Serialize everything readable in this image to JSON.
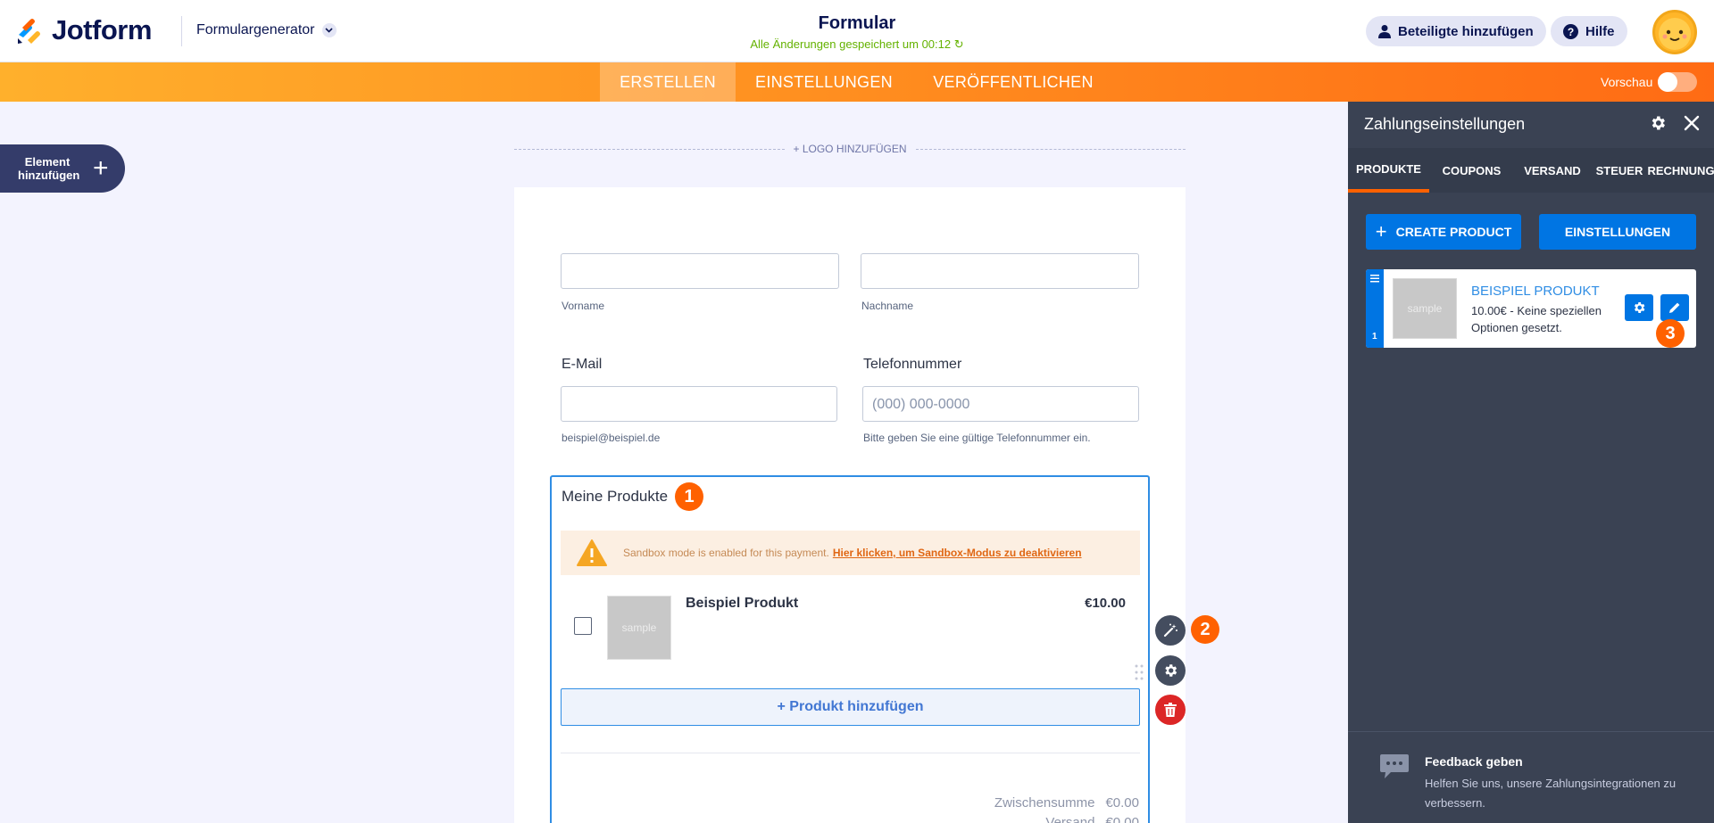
{
  "header": {
    "logo_text": "Jotform",
    "builder_menu": "Formulargenerator",
    "form_title": "Formular",
    "save_status": "Alle Änderungen gespeichert um 00:12",
    "add_participants": "Beteiligte hinzufügen",
    "help": "Hilfe"
  },
  "navbar": {
    "tabs": [
      {
        "label": "ERSTELLEN",
        "active": true
      },
      {
        "label": "EINSTELLUNGEN",
        "active": false
      },
      {
        "label": "VERÖFFENTLICHEN",
        "active": false
      }
    ],
    "preview_label": "Vorschau"
  },
  "sidebar": {
    "add_element_label": "Element hinzufügen"
  },
  "form": {
    "logo_add": "+ LOGO HINZUFÜGEN",
    "first_name_sub": "Vorname",
    "last_name_sub": "Nachname",
    "email_label": "E-Mail",
    "email_sub": "beispiel@beispiel.de",
    "phone_label": "Telefonnummer",
    "phone_placeholder": "(000) 000-0000",
    "phone_sub": "Bitte geben Sie eine gültige Telefonnummer ein.",
    "products": {
      "title": "Meine Produkte",
      "badge": "1",
      "sandbox_text": "Sandbox mode is enabled for this payment.",
      "sandbox_link": "Hier klicken, um Sandbox-Modus zu deaktivieren",
      "item_name": "Beispiel Produkt",
      "item_price": "€10.00",
      "thumb_text": "sample",
      "add_product": "+ Produkt hinzufügen",
      "subtotal_label": "Zwischensumme",
      "subtotal_value": "€0.00",
      "shipping_label": "Versand",
      "shipping_value": "€0.00"
    },
    "badge_2": "2"
  },
  "panel": {
    "title": "Zahlungseinstellungen",
    "tabs": [
      "PRODUKTE",
      "COUPONS",
      "VERSAND",
      "STEUER",
      "RECHNUNG"
    ],
    "create_product": "CREATE PRODUCT",
    "settings": "EINSTELLUNGEN",
    "product": {
      "index": "1",
      "thumb_text": "sample",
      "name": "BEISPIEL PRODUKT",
      "desc": "10.00€ - Keine speziellen Optionen gesetzt."
    },
    "badge_3": "3",
    "feedback_title": "Feedback geben",
    "feedback_text": "Helfen Sie uns, unsere Zahlungsintegrationen zu verbessern."
  },
  "colors": {
    "accent_orange": "#ff6100",
    "primary_blue": "#0075e3",
    "panel_bg": "#3a4253",
    "header_text": "#0a1551"
  }
}
